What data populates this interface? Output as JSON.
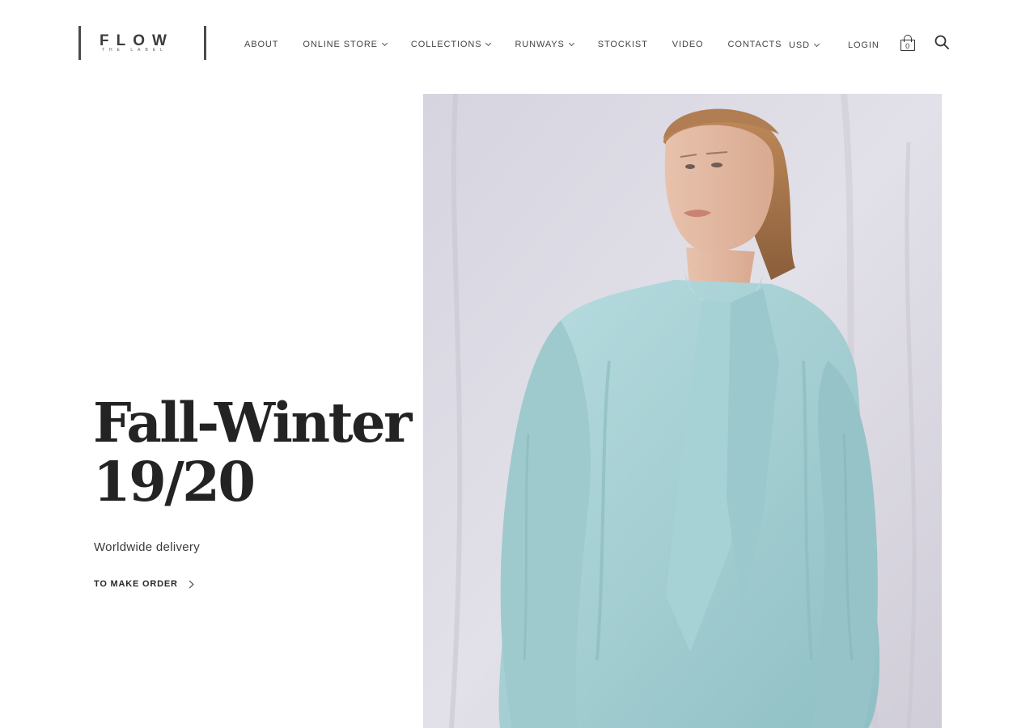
{
  "brand": {
    "name": "FLOW",
    "tagline": "THE LABEL"
  },
  "nav": {
    "items": [
      {
        "label": "ABOUT",
        "dropdown": false
      },
      {
        "label": "ONLINE STORE",
        "dropdown": true
      },
      {
        "label": "COLLECTIONS",
        "dropdown": true
      },
      {
        "label": "RUNWAYS",
        "dropdown": true
      },
      {
        "label": "STOCKIST",
        "dropdown": false
      },
      {
        "label": "VIDEO",
        "dropdown": false
      },
      {
        "label": "CONTACTS",
        "dropdown": false
      }
    ]
  },
  "utils": {
    "currency": "USD",
    "login": "LOGIN",
    "cart_count": "0",
    "cart_icon": "shopping-bag-icon",
    "search_icon": "search-icon"
  },
  "hero": {
    "title_line1": "Fall-Winter",
    "title_line2": "19/20",
    "subtitle": "Worldwide delivery",
    "cta_label": "TO MAKE ORDER",
    "cta_icon": "chevron-right-icon",
    "image_alt": "Model in pale blue silk blouse with tie neck"
  },
  "colors": {
    "text": "#232323",
    "backdrop": "#dcdae3",
    "garment": "#a9d3d6"
  }
}
